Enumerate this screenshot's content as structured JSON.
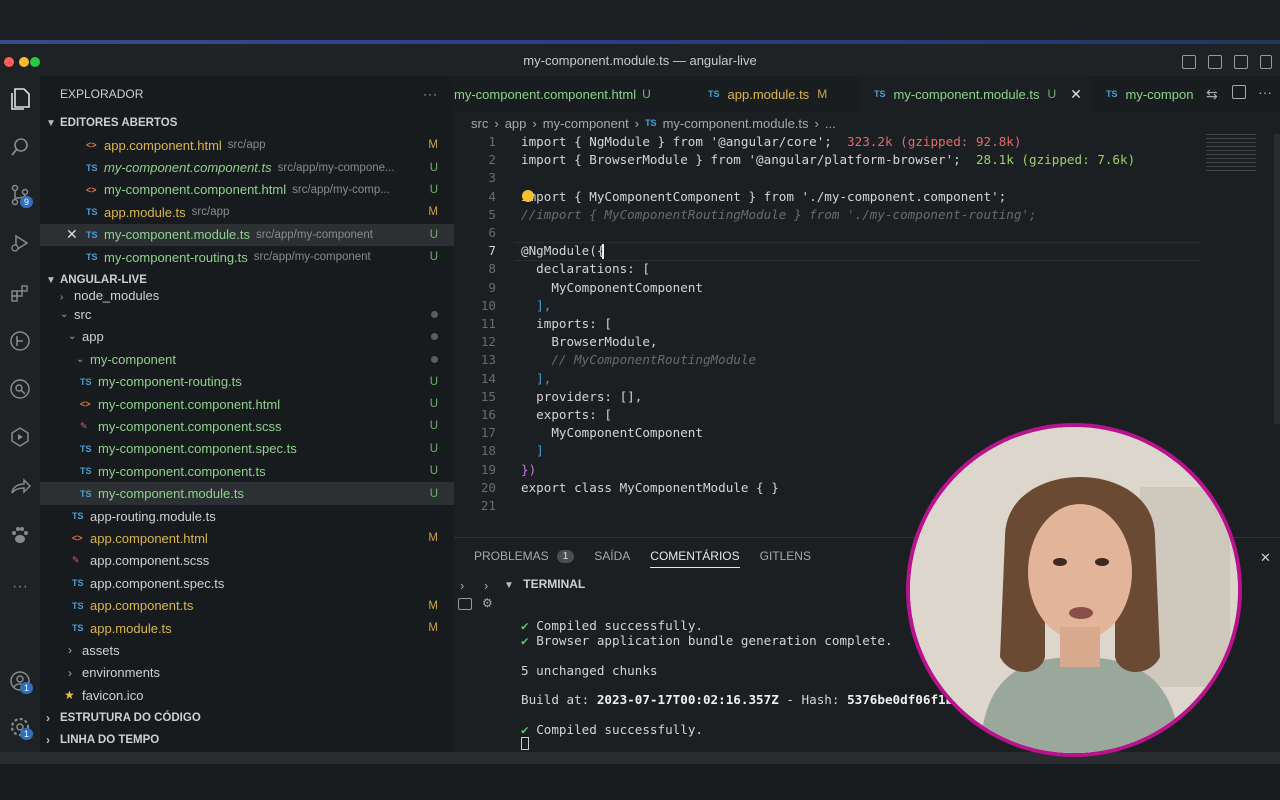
{
  "window": {
    "title": "my-component.module.ts — angular-live"
  },
  "activity_bar": {
    "items": [
      {
        "icon": "files-icon"
      },
      {
        "icon": "search-icon"
      },
      {
        "icon": "source-control-icon",
        "badge": "9"
      },
      {
        "icon": "run-debug-icon"
      },
      {
        "icon": "extensions-icon"
      },
      {
        "icon": "gitlens-icon"
      },
      {
        "icon": "remote-explorer-icon"
      },
      {
        "icon": "testing-icon"
      },
      {
        "icon": "live-share-icon"
      },
      {
        "icon": "paw-icon"
      },
      {
        "icon": "more-icon"
      }
    ],
    "account_badge": "1"
  },
  "sidebar": {
    "title": "EXPLORADOR",
    "open_editors": {
      "label": "EDITORES ABERTOS",
      "items": [
        {
          "icon": "<>",
          "name": "app.component.html",
          "path": "src/app",
          "status": "M"
        },
        {
          "icon": "TS",
          "name": "my-component.component.ts",
          "path": "src/app/my-compone...",
          "status": "U"
        },
        {
          "icon": "<>",
          "name": "my-component.component.html",
          "path": "src/app/my-comp...",
          "status": "U"
        },
        {
          "icon": "TS",
          "name": "app.module.ts",
          "path": "src/app",
          "status": "M"
        },
        {
          "icon": "TS",
          "name": "my-component.module.ts",
          "path": "src/app/my-component",
          "status": "U"
        },
        {
          "icon": "TS",
          "name": "my-component-routing.ts",
          "path": "src/app/my-component",
          "status": "U"
        }
      ]
    },
    "project": {
      "label": "ANGULAR-LIVE",
      "tree": [
        {
          "name": "node_modules",
          "kind": "folder"
        },
        {
          "name": "src",
          "kind": "folder"
        },
        {
          "name": "app",
          "kind": "folder"
        },
        {
          "name": "my-component",
          "kind": "folder"
        },
        {
          "name": "my-component-routing.ts",
          "icon": "TS",
          "status": "U"
        },
        {
          "name": "my-component.component.html",
          "icon": "<>",
          "status": "U"
        },
        {
          "name": "my-component.component.scss",
          "icon": "scss",
          "status": "U"
        },
        {
          "name": "my-component.component.spec.ts",
          "icon": "TS",
          "status": "U"
        },
        {
          "name": "my-component.component.ts",
          "icon": "TS",
          "status": "U"
        },
        {
          "name": "my-component.module.ts",
          "icon": "TS",
          "status": "U"
        },
        {
          "name": "app-routing.module.ts",
          "icon": "TS",
          "status": ""
        },
        {
          "name": "app.component.html",
          "icon": "<>",
          "status": "M"
        },
        {
          "name": "app.component.scss",
          "icon": "scss",
          "status": ""
        },
        {
          "name": "app.component.spec.ts",
          "icon": "TS",
          "status": ""
        },
        {
          "name": "app.component.ts",
          "icon": "TS",
          "status": "M"
        },
        {
          "name": "app.module.ts",
          "icon": "TS",
          "status": "M"
        },
        {
          "name": "assets",
          "kind": "folder"
        },
        {
          "name": "environments",
          "kind": "folder"
        },
        {
          "name": "favicon.ico",
          "icon": "star"
        }
      ]
    },
    "outline_label": "ESTRUTURA DO CÓDIGO",
    "timeline_label": "LINHA DO TEMPO"
  },
  "editor": {
    "tabs": [
      {
        "name": "my-component.component.html",
        "status": "U"
      },
      {
        "name": "app.module.ts",
        "status": "M"
      },
      {
        "name": "my-component.module.ts",
        "status": "U",
        "active": true
      },
      {
        "name": "my-compon"
      }
    ],
    "breadcrumb": [
      "src",
      "app",
      "my-component",
      "my-component.module.ts",
      "..."
    ],
    "line_numbers": [
      "1",
      "2",
      "3",
      "4",
      "5",
      "6",
      "7",
      "8",
      "9",
      "10",
      "11",
      "12",
      "13",
      "14",
      "15",
      "16",
      "17",
      "18",
      "19",
      "20",
      "21"
    ],
    "current_line": "7",
    "code": {
      "l1_a": "import { NgModule } from '@angular/core';",
      "l1_size": "323.2k (gzipped: 92.8k)",
      "l2_a": "import { BrowserModule } from '@angular/platform-browser';",
      "l2_size": "28.1k (gzipped: 7.6k)",
      "l4": "import { MyComponentComponent } from './my-component.component';",
      "l5": "//import { MyComponentRoutingModule } from './my-component-routing';",
      "l7": "@NgModule({",
      "l8": "  declarations: [",
      "l9": "    MyComponentComponent",
      "l10": "  ],",
      "l11": "  imports: [",
      "l12": "    BrowserModule,",
      "l13": "    // MyComponentRoutingModule",
      "l14": "  ],",
      "l15": "  providers: [],",
      "l16": "  exports: [",
      "l17": "    MyComponentComponent",
      "l18": "  ]",
      "l19": "})",
      "l20": "export class MyComponentModule { }"
    }
  },
  "panel": {
    "tabs": [
      {
        "label": "PROBLEMAS",
        "badge": "1"
      },
      {
        "label": "SAÍDA"
      },
      {
        "label": "COMENTÁRIOS",
        "active": true
      },
      {
        "label": "GITLENS"
      }
    ],
    "terminal_label": "TERMINAL",
    "lines": {
      "t1": "Compiled successfully.",
      "t2": "Browser application bundle generation complete.",
      "t3": "5 unchanged chunks",
      "t4_a": "Build at: ",
      "t4_b": "2023-07-17T00:02:16.357Z",
      "t4_c": " - Hash: ",
      "t4_d": "5376be0df06f1bc1",
      "t4_e": " -",
      "t5": "Compiled successfully."
    },
    "check_glyph": "✔"
  },
  "colors": {
    "accent_modified": "#c9a348",
    "accent_untracked": "#6cb56c",
    "webcam_border": "#b8138c"
  }
}
